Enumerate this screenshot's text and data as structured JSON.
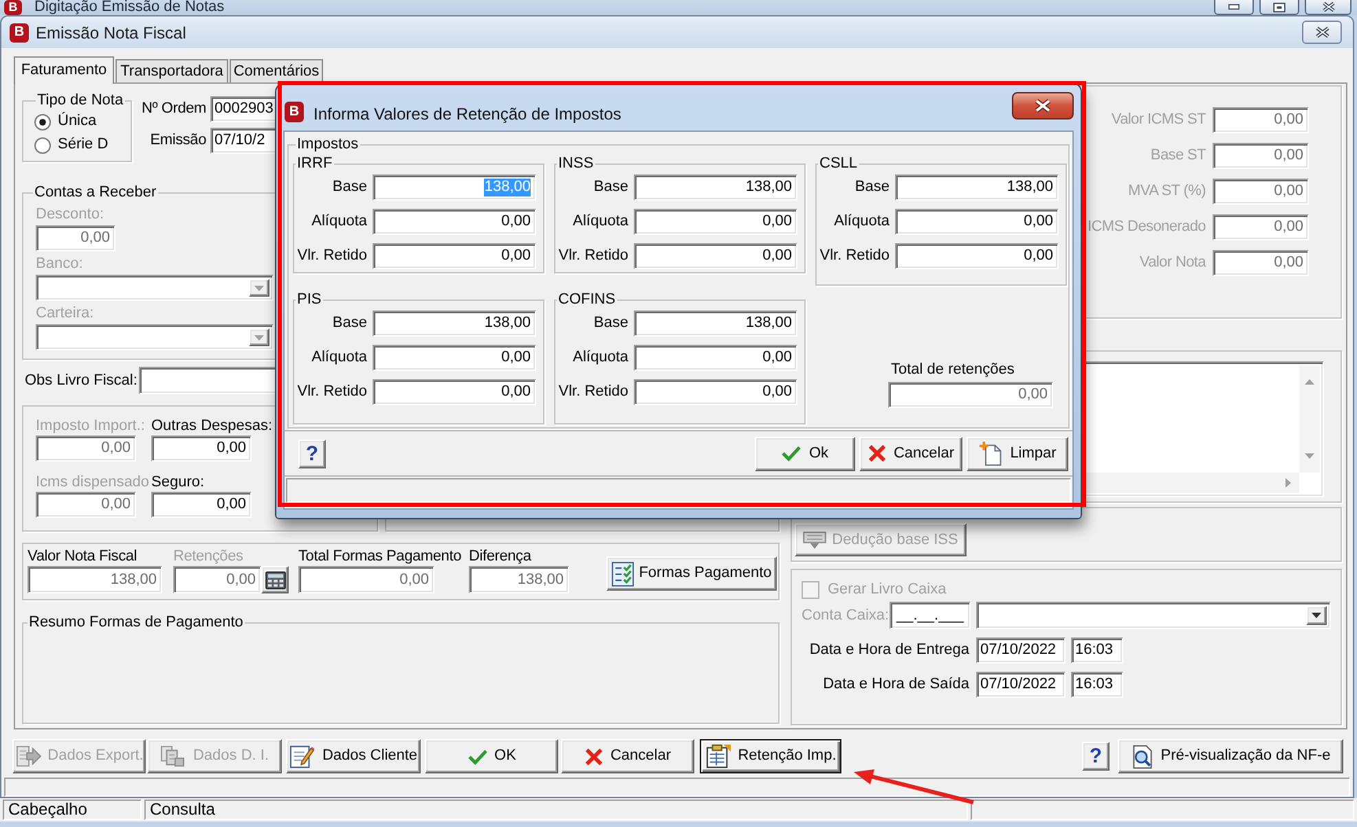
{
  "main_window": {
    "logo": "B",
    "title": "Digitação Emissão de Notas"
  },
  "window": {
    "logo": "B",
    "title": "Emissão Nota Fiscal"
  },
  "tabs": [
    {
      "label": "Faturamento",
      "selected": true
    },
    {
      "label": "Transportadora",
      "selected": false
    },
    {
      "label": "Comentários",
      "selected": false
    }
  ],
  "tipo_de_nota": {
    "title": "Tipo de Nota",
    "options": [
      {
        "label": "Única",
        "selected": true
      },
      {
        "label": "Série D",
        "selected": false
      }
    ]
  },
  "header_fields": [
    {
      "label": "Nº Ordem",
      "value": "0002903"
    },
    {
      "label": "Emissão",
      "value": "07/10/2"
    }
  ],
  "contas_a_receber": {
    "title": "Contas a Receber",
    "fields": [
      {
        "kind": "text",
        "label": "Desconto:",
        "value": "0,00",
        "disabled": true
      },
      {
        "kind": "combo",
        "label": "Banco:",
        "disabled": true
      },
      {
        "kind": "combo",
        "label": "Carteira:",
        "disabled": true
      }
    ]
  },
  "obs_livro_fiscal": {
    "label": "Obs Livro Fiscal:"
  },
  "despesas": [
    {
      "label": "Imposto Import.:",
      "value": "0,00",
      "disabled": true
    },
    {
      "label": "Outras Despesas:",
      "value": "0,00",
      "disabled": false
    },
    {
      "label": "Icms dispensado",
      "value": "0,00",
      "disabled": true
    },
    {
      "label": "Seguro:",
      "value": "0,00",
      "disabled": false
    }
  ],
  "totals": [
    {
      "label": "Valor Nota Fiscal",
      "value": "138,00",
      "disabled": false
    },
    {
      "label": "Retenções",
      "value": "0,00",
      "disabled": true
    },
    {
      "label": "Total Formas Pagamento",
      "value": "0,00",
      "disabled": false
    },
    {
      "label": "Diferença",
      "value": "138,00",
      "disabled": false
    }
  ],
  "formas_pagamento_button": {
    "label": "Formas Pagamento"
  },
  "resumo_formas_pagamento": {
    "title": "Resumo Formas de Pagamento"
  },
  "st_fields": [
    {
      "label": "Valor ICMS ST",
      "value": "0,00",
      "disabled": true
    },
    {
      "label": "Base ST",
      "value": "0,00",
      "disabled": true
    },
    {
      "label": "MVA ST (%)",
      "value": "0,00",
      "disabled": true
    },
    {
      "label": "ICMS Desonerado",
      "value": "0,00",
      "disabled": true
    },
    {
      "label": "Valor Nota",
      "value": "0,00",
      "disabled": true
    }
  ],
  "deducao_button": {
    "label": "Dedução base ISS",
    "disabled": true
  },
  "livro_caixa": {
    "checkbox": {
      "label": "Gerar Livro Caixa",
      "checked": false,
      "disabled": true
    },
    "conta_caixa": {
      "label": "Conta Caixa:",
      "value": "__.__.___",
      "disabled": true
    },
    "datetimes": [
      {
        "label": "Data e Hora de Entrega",
        "date": "07/10/2022",
        "time": "16:03"
      },
      {
        "label": "Data e Hora de Saída",
        "date": "07/10/2022",
        "time": "16:03"
      }
    ]
  },
  "buttons": [
    {
      "label": "Dados Export.",
      "disabled": true,
      "focused": false
    },
    {
      "label": "Dados D. I.",
      "disabled": true,
      "focused": false
    },
    {
      "label": "Dados Cliente",
      "disabled": false,
      "focused": false
    },
    {
      "label": "OK",
      "disabled": false,
      "focused": false
    },
    {
      "label": "Cancelar",
      "disabled": false,
      "focused": false
    },
    {
      "label": "Retenção Imp.",
      "disabled": false,
      "focused": true
    }
  ],
  "help_button": {
    "label": "?"
  },
  "preview_button": {
    "label": "Pré-visualização da NF-e"
  },
  "status_bar": [
    "Cabeçalho",
    "Consulta"
  ],
  "dialog": {
    "logo": "B",
    "title": "Informa Valores de Retenção de Impostos",
    "group_title": "Impostos",
    "taxes": [
      {
        "name": "IRRF",
        "fields": [
          {
            "label": "Base",
            "value": "138,00",
            "selected": true
          },
          {
            "label": "Alíquota",
            "value": "0,00",
            "selected": false
          },
          {
            "label": "Vlr. Retido",
            "value": "0,00",
            "selected": false
          }
        ]
      },
      {
        "name": "INSS",
        "fields": [
          {
            "label": "Base",
            "value": "138,00",
            "selected": false
          },
          {
            "label": "Alíquota",
            "value": "0,00",
            "selected": false
          },
          {
            "label": "Vlr. Retido",
            "value": "0,00",
            "selected": false
          }
        ]
      },
      {
        "name": "CSLL",
        "fields": [
          {
            "label": "Base",
            "value": "138,00",
            "selected": false
          },
          {
            "label": "Alíquota",
            "value": "0,00",
            "selected": false
          },
          {
            "label": "Vlr. Retido",
            "value": "0,00",
            "selected": false
          }
        ]
      },
      {
        "name": "PIS",
        "fields": [
          {
            "label": "Base",
            "value": "138,00",
            "selected": false
          },
          {
            "label": "Alíquota",
            "value": "0,00",
            "selected": false
          },
          {
            "label": "Vlr. Retido",
            "value": "0,00",
            "selected": false
          }
        ]
      },
      {
        "name": "COFINS",
        "fields": [
          {
            "label": "Base",
            "value": "138,00",
            "selected": false
          },
          {
            "label": "Alíquota",
            "value": "0,00",
            "selected": false
          },
          {
            "label": "Vlr. Retido",
            "value": "0,00",
            "selected": false
          }
        ]
      }
    ],
    "total": {
      "label": "Total de retenções",
      "value": "0,00"
    },
    "help_button": {
      "label": "?"
    },
    "buttons": [
      {
        "label": "Ok"
      },
      {
        "label": "Cancelar"
      },
      {
        "label": "Limpar"
      }
    ]
  }
}
